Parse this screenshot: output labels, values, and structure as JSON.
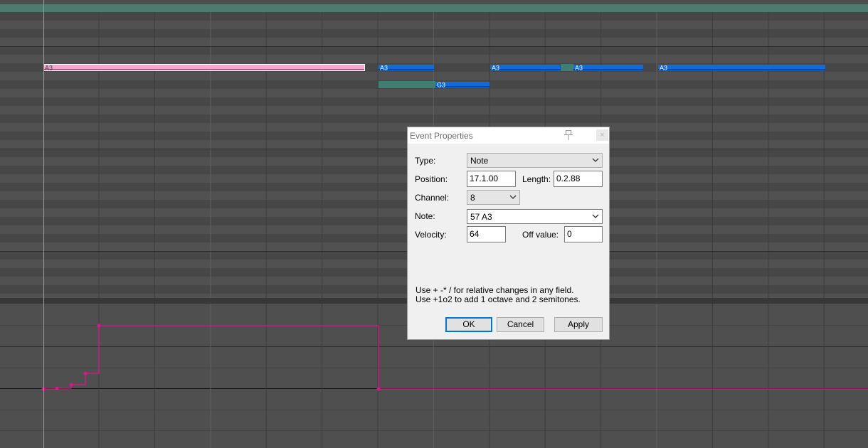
{
  "colors": {
    "background": "#4e4e4e",
    "row_dark": "#474747",
    "row_light": "#515151",
    "top_bar": "#4f7a70",
    "note_blue": "#0f6cdc",
    "note_pink": "#f6a6cf",
    "note_teal": "#3f7f72",
    "velocity_line": "#e0138c",
    "playhead": "#5ab9a7"
  },
  "piano_roll": {
    "notes": [
      {
        "label": "A3",
        "color": "pink",
        "selected": true
      },
      {
        "label": "A3",
        "color": "blue",
        "selected": false
      },
      {
        "label": "A3",
        "color": "blue",
        "selected": false
      },
      {
        "label": "A3",
        "color": "blue",
        "selected": false
      },
      {
        "label": "A3",
        "color": "blue",
        "selected": false
      },
      {
        "label": "G3",
        "color": "blue",
        "selected": false
      }
    ]
  },
  "dialog": {
    "title": "Event Properties",
    "type_label": "Type:",
    "type_value": "Note",
    "position_label": "Position:",
    "position_value": "17.1.00",
    "length_label": "Length:",
    "length_value": "0.2.88",
    "channel_label": "Channel:",
    "channel_value": "8",
    "note_label": "Note:",
    "note_value": "57 A3",
    "velocity_label": "Velocity:",
    "velocity_value": "64",
    "offvalue_label": "Off value:",
    "offvalue_value": "0",
    "hint_line1": "Use + -* / for relative changes in any field.",
    "hint_line2": "Use +1o2  to add 1 octave and 2 semitones.",
    "ok_label": "OK",
    "cancel_label": "Cancel",
    "apply_label": "Apply",
    "close_glyph": "×",
    "pin_icon": "pin-icon"
  }
}
